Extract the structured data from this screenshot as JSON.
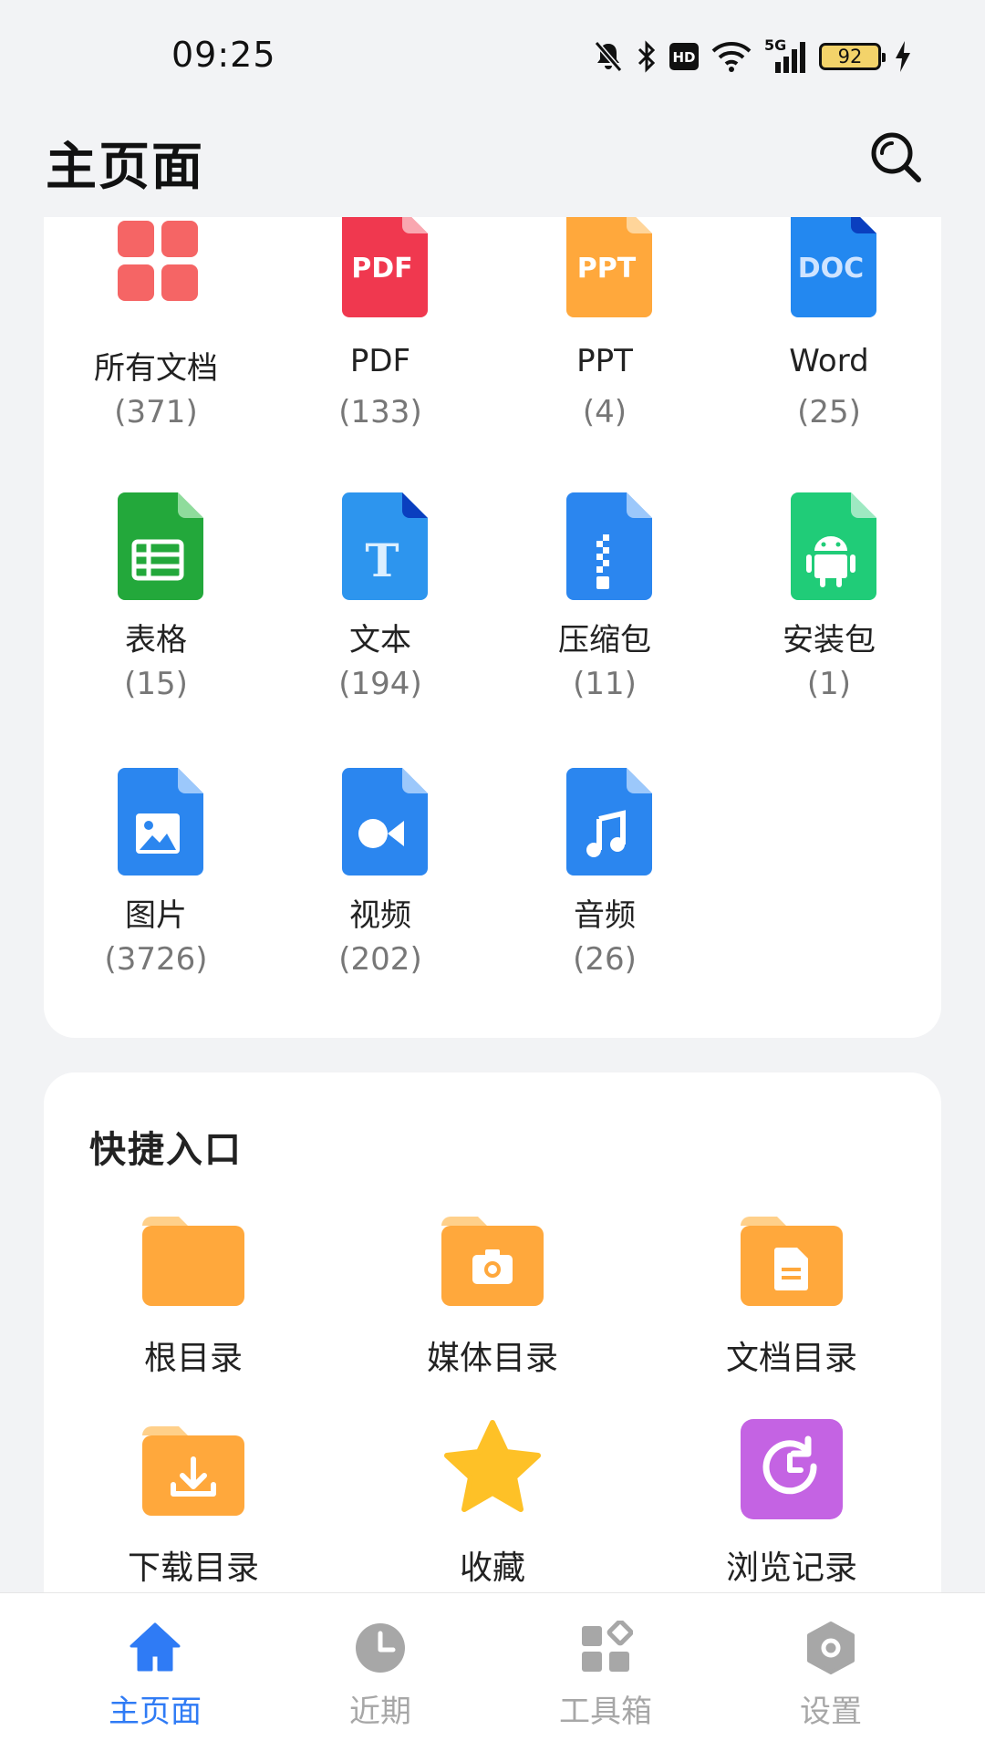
{
  "status_bar": {
    "time": "09:25",
    "network": "5G",
    "hd": "HD",
    "battery": "92",
    "icons": [
      "bell-off-icon",
      "bluetooth-icon",
      "hd-icon",
      "wifi-icon",
      "signal-icon",
      "battery-icon",
      "charging-icon"
    ]
  },
  "header": {
    "title": "主页面",
    "search_icon": "search-icon"
  },
  "file_types": [
    {
      "label": "所有文档",
      "count": "(371)",
      "icon": "all-docs-icon",
      "color": "#f56565"
    },
    {
      "label": "PDF",
      "count": "(133)",
      "icon": "pdf-icon",
      "icon_text": "PDF",
      "color": "#f0384f"
    },
    {
      "label": "PPT",
      "count": "(4)",
      "icon": "ppt-icon",
      "icon_text": "PPT",
      "color": "#ffa83c"
    },
    {
      "label": "Word",
      "count": "(25)",
      "icon": "word-icon",
      "icon_text": "DOC",
      "color": "#2388f0"
    },
    {
      "label": "表格",
      "count": "(15)",
      "icon": "spreadsheet-icon",
      "color": "#23a83b"
    },
    {
      "label": "文本",
      "count": "(194)",
      "icon": "text-icon",
      "icon_text": "T",
      "color": "#2d95ee"
    },
    {
      "label": "压缩包",
      "count": "(11)",
      "icon": "zip-icon",
      "color": "#2b86ef"
    },
    {
      "label": "安装包",
      "count": "(1)",
      "icon": "apk-icon",
      "color": "#20cc78"
    },
    {
      "label": "图片",
      "count": "(3726)",
      "icon": "image-icon",
      "color": "#2b86ef"
    },
    {
      "label": "视频",
      "count": "(202)",
      "icon": "video-icon",
      "color": "#2b86ef"
    },
    {
      "label": "音频",
      "count": "(26)",
      "icon": "audio-icon",
      "color": "#2b86ef"
    }
  ],
  "quick_access": {
    "title": "快捷入口",
    "items": [
      {
        "label": "根目录",
        "icon": "folder-icon"
      },
      {
        "label": "媒体目录",
        "icon": "media-folder-icon"
      },
      {
        "label": "文档目录",
        "icon": "document-folder-icon"
      },
      {
        "label": "下载目录",
        "icon": "download-folder-icon"
      },
      {
        "label": "收藏",
        "icon": "star-icon"
      },
      {
        "label": "浏览记录",
        "icon": "history-icon"
      }
    ]
  },
  "bottom_nav": [
    {
      "label": "主页面",
      "icon": "home-icon",
      "active": true
    },
    {
      "label": "近期",
      "icon": "clock-icon",
      "active": false
    },
    {
      "label": "工具箱",
      "icon": "toolbox-icon",
      "active": false
    },
    {
      "label": "设置",
      "icon": "settings-icon",
      "active": false
    }
  ],
  "colors": {
    "accent": "#2f7bf5",
    "folder": "#ffa83c",
    "star": "#fec127",
    "history": "#c463e3",
    "inactive": "#a7a7a7"
  }
}
